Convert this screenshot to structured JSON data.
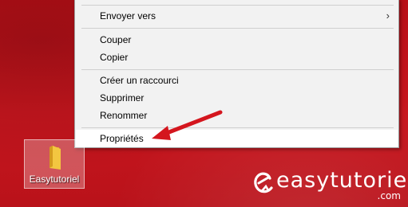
{
  "context_menu": {
    "items": [
      {
        "label": "Envoyer vers",
        "has_submenu": true
      },
      {
        "label": "Couper"
      },
      {
        "label": "Copier"
      },
      {
        "label": "Créer un raccourci"
      },
      {
        "label": "Supprimer"
      },
      {
        "label": "Renommer"
      },
      {
        "label": "Propriétés"
      }
    ],
    "submenu_arrow": "›"
  },
  "desktop": {
    "icon": {
      "label": "Easytutoriel",
      "icon_name": "folder-icon",
      "folder_color": "#f3c640"
    }
  },
  "annotation": {
    "arrow_color": "#d4161e"
  },
  "watermark": {
    "brand": "easytutoriel",
    "domain": ".com"
  }
}
